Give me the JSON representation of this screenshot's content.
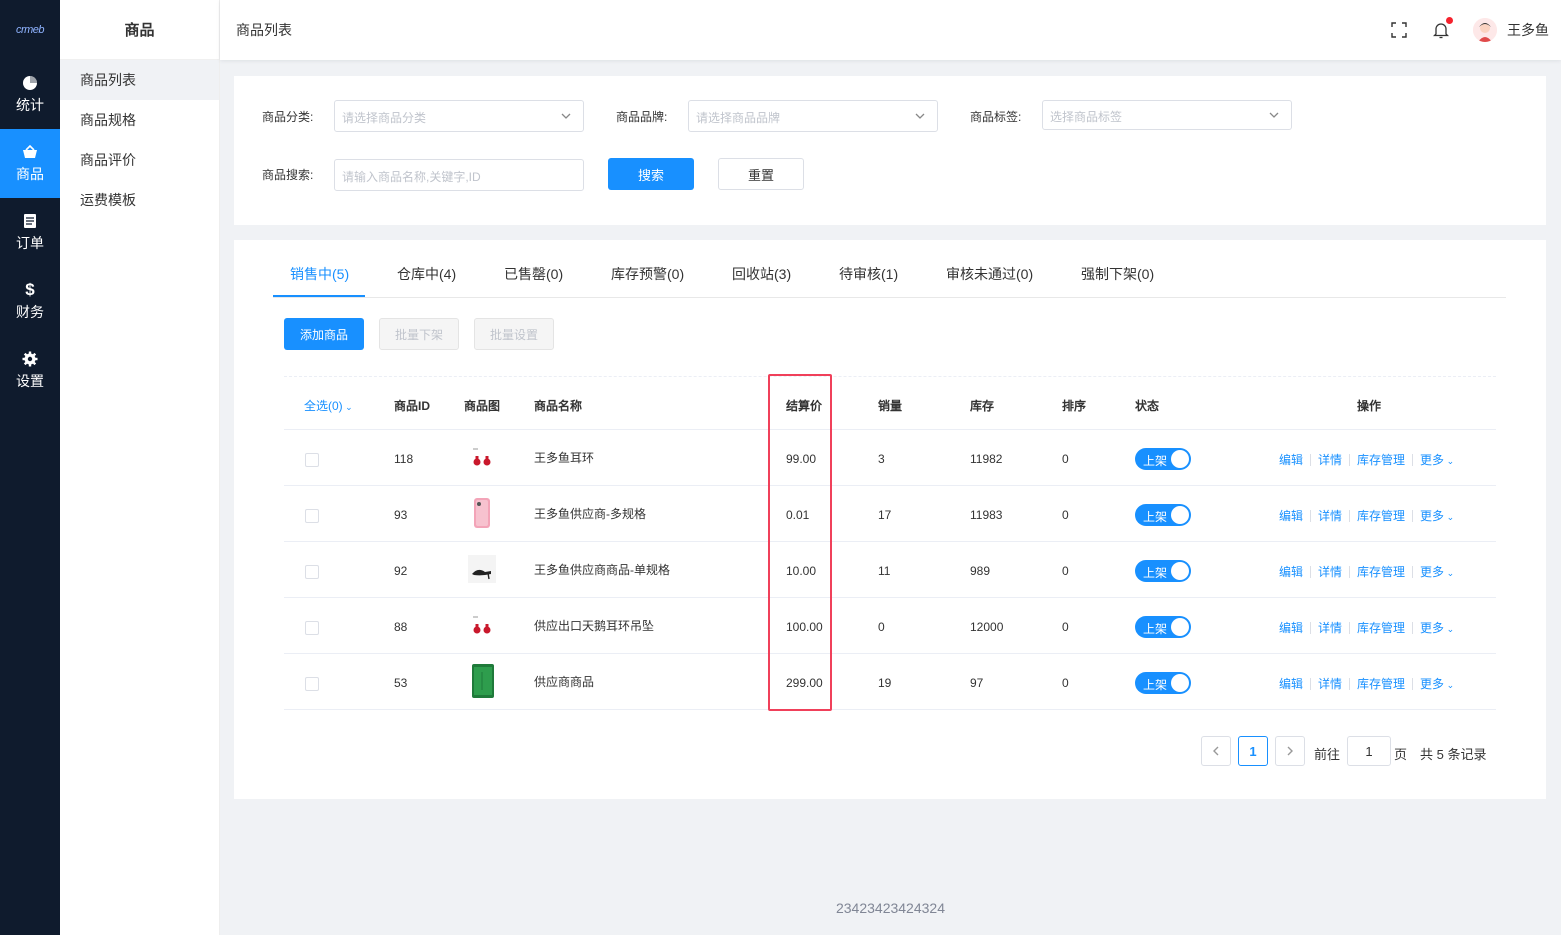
{
  "logo": "crmeb",
  "nav": {
    "items": [
      {
        "label": "统计",
        "icon": "pie-chart-icon"
      },
      {
        "label": "商品",
        "icon": "shopping-basket-icon"
      },
      {
        "label": "订单",
        "icon": "document-icon"
      },
      {
        "label": "财务",
        "icon": "dollar-icon"
      },
      {
        "label": "设置",
        "icon": "gear-icon"
      }
    ]
  },
  "subnav": {
    "title": "商品",
    "items": [
      "商品列表",
      "商品规格",
      "商品评价",
      "运费模板"
    ]
  },
  "header": {
    "breadcrumb": "商品列表",
    "username": "王多鱼"
  },
  "filter": {
    "category_label": "商品分类:",
    "category_placeholder": "请选择商品分类",
    "brand_label": "商品品牌:",
    "brand_placeholder": "请选择商品品牌",
    "tag_label": "商品标签:",
    "tag_placeholder": "选择商品标签",
    "search_label": "商品搜索:",
    "search_placeholder": "请输入商品名称,关键字,ID",
    "search_button": "搜索",
    "reset_button": "重置"
  },
  "tabs": [
    "销售中(5)",
    "仓库中(4)",
    "已售罄(0)",
    "库存预警(0)",
    "回收站(3)",
    "待审核(1)",
    "审核未通过(0)",
    "强制下架(0)"
  ],
  "actions": {
    "add": "添加商品",
    "batch_off": "批量下架",
    "batch_set": "批量设置"
  },
  "table": {
    "headers": {
      "select_all": "全选(0)",
      "id": "商品ID",
      "image": "商品图",
      "name": "商品名称",
      "price": "结算价",
      "sales": "销量",
      "stock": "库存",
      "sort": "排序",
      "status": "状态",
      "ops": "操作"
    },
    "rows": [
      {
        "id": "118",
        "image": "earrings-thumb",
        "name": "王多鱼耳环",
        "price": "99.00",
        "sales": "3",
        "stock": "11982",
        "sort": "0",
        "status": "上架"
      },
      {
        "id": "93",
        "image": "pink-phone-thumb",
        "name": "王多鱼供应商-多规格",
        "price": "0.01",
        "sales": "17",
        "stock": "11983",
        "sort": "0",
        "status": "上架"
      },
      {
        "id": "92",
        "image": "high-heel-thumb",
        "name": "王多鱼供应商商品-单规格",
        "price": "10.00",
        "sales": "11",
        "stock": "989",
        "sort": "0",
        "status": "上架"
      },
      {
        "id": "88",
        "image": "earrings-thumb",
        "name": "供应出口天鹅耳环吊坠",
        "price": "100.00",
        "sales": "0",
        "stock": "12000",
        "sort": "0",
        "status": "上架"
      },
      {
        "id": "53",
        "image": "green-phone-thumb",
        "name": "供应商商品",
        "price": "299.00",
        "sales": "19",
        "stock": "97",
        "sort": "0",
        "status": "上架"
      }
    ],
    "op_labels": {
      "edit": "编辑",
      "detail": "详情",
      "stock": "库存管理",
      "more": "更多"
    }
  },
  "pagination": {
    "current": "1",
    "goto_label": "前往",
    "goto_value": "1",
    "page_suffix": "页",
    "total_text": "共 5 条记录"
  },
  "footer": "23423423424324",
  "colors": {
    "primary": "#1890ff",
    "nav_bg": "#0f1b2d",
    "highlight": "#f0405a"
  }
}
